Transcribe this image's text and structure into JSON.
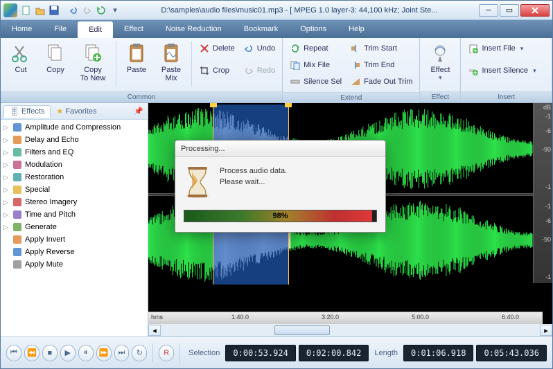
{
  "title": "D:\\samples\\audio files\\music01.mp3 - [ MPEG 1.0 layer-3: 44,100 kHz; Joint Ste...",
  "menu": [
    "Home",
    "File",
    "Edit",
    "Effect",
    "Noise Reduction",
    "Bookmark",
    "Options",
    "Help"
  ],
  "menu_active": 2,
  "ribbon": {
    "groups": [
      {
        "label": "Common",
        "big": [
          {
            "id": "cut",
            "label": "Cut"
          },
          {
            "id": "copy",
            "label": "Copy"
          },
          {
            "id": "copy-to-new",
            "label": "Copy\nTo New"
          },
          {
            "id": "paste",
            "label": "Paste"
          },
          {
            "id": "paste-mix",
            "label": "Paste\nMix"
          }
        ],
        "small": [
          {
            "id": "delete",
            "label": "Delete"
          },
          {
            "id": "crop",
            "label": "Crop"
          },
          {
            "id": "undo",
            "label": "Undo"
          },
          {
            "id": "redo",
            "label": "Redo",
            "disabled": true
          }
        ]
      },
      {
        "label": "Extend",
        "small": [
          {
            "id": "repeat",
            "label": "Repeat"
          },
          {
            "id": "mix-file",
            "label": "Mix File"
          },
          {
            "id": "silence-sel",
            "label": "Silence Sel"
          },
          {
            "id": "trim-start",
            "label": "Trim Start"
          },
          {
            "id": "trim-end",
            "label": "Trim End"
          },
          {
            "id": "fade-out-trim",
            "label": "Fade Out Trim"
          }
        ]
      },
      {
        "label": "Effect",
        "big": [
          {
            "id": "effect",
            "label": "Effect"
          }
        ]
      },
      {
        "label": "Insert",
        "small": [
          {
            "id": "insert-file",
            "label": "Insert File"
          },
          {
            "id": "insert-silence",
            "label": "Insert Silence"
          }
        ]
      }
    ]
  },
  "sidebar": {
    "tabs": [
      {
        "id": "effects",
        "label": "Effects",
        "active": true
      },
      {
        "id": "favorites",
        "label": "Favorites"
      }
    ],
    "tree": [
      {
        "label": "Amplitude and Compression",
        "expandable": true,
        "icon": "wave"
      },
      {
        "label": "Delay and Echo",
        "expandable": true,
        "icon": "clock"
      },
      {
        "label": "Filters and EQ",
        "expandable": true,
        "icon": "sliders"
      },
      {
        "label": "Modulation",
        "expandable": true,
        "icon": "people"
      },
      {
        "label": "Restoration",
        "expandable": true,
        "icon": "swatch"
      },
      {
        "label": "Special",
        "expandable": true,
        "icon": "star"
      },
      {
        "label": "Stereo Imagery",
        "expandable": true,
        "icon": "stereo"
      },
      {
        "label": "Time and Pitch",
        "expandable": true,
        "icon": "time"
      },
      {
        "label": "Generate",
        "expandable": true,
        "icon": "gen"
      },
      {
        "label": "Apply Invert",
        "expandable": false,
        "icon": "invert"
      },
      {
        "label": "Apply Reverse",
        "expandable": false,
        "icon": "reverse"
      },
      {
        "label": "Apply Mute",
        "expandable": false,
        "icon": "mute"
      }
    ]
  },
  "db_scale": {
    "header": "dB",
    "marks": [
      "-1",
      "-6",
      "-90",
      "-1",
      "-1",
      "-6",
      "-90",
      "-1"
    ]
  },
  "time_ruler": {
    "unit": "hms",
    "ticks": [
      "1:40.0",
      "3:20.0",
      "5:00.0",
      "6:40.0"
    ]
  },
  "status": {
    "selection_label": "Selection",
    "length_label": "Length",
    "sel_start": "0:00:53.924",
    "sel_end": "0:02:00.842",
    "len_a": "0:01:06.918",
    "len_b": "0:05:43.036"
  },
  "dialog": {
    "title": "Processing...",
    "line1": "Process audio data.",
    "line2": "Please wait...",
    "percent": "98%"
  }
}
